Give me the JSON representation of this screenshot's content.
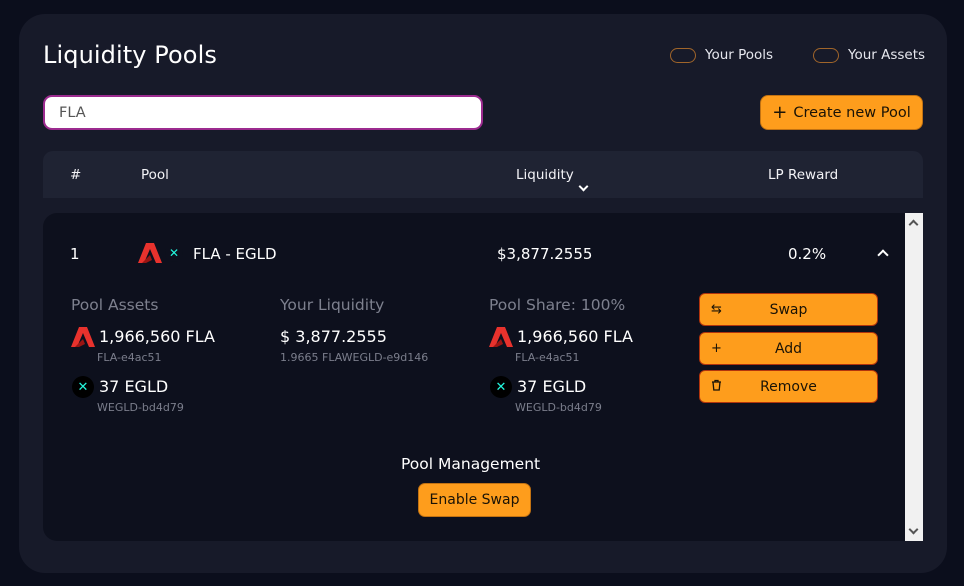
{
  "header": {
    "title": "Liquidity Pools",
    "toggles": [
      {
        "label": "Your Pools",
        "on": false
      },
      {
        "label": "Your Assets",
        "on": false
      }
    ]
  },
  "search": {
    "value": "FLA",
    "placeholder": ""
  },
  "create_button": {
    "label": "Create new Pool",
    "icon": "plus-icon"
  },
  "table": {
    "columns": [
      "#",
      "Pool",
      "Liquidity",
      "LP Reward"
    ],
    "sort_column": "Liquidity"
  },
  "pool": {
    "index": "1",
    "pair": "FLA - EGLD",
    "liquidity": "$3,877.2555",
    "lp_reward": "0.2%",
    "pool_assets": {
      "title": "Pool Assets",
      "token1_amount": "1,966,560 FLA",
      "token1_id": "FLA-e4ac51",
      "token2_amount": "37 EGLD",
      "token2_id": "WEGLD-bd4d79"
    },
    "your_liquidity": {
      "title": "Your Liquidity",
      "value": "$ 3,877.2555",
      "lp_tokens": "1.9665 FLAWEGLD-e9d146"
    },
    "pool_share": {
      "title": "Pool Share: 100%",
      "token1_amount": "1,966,560 FLA",
      "token1_id": "FLA-e4ac51",
      "token2_amount": "37 EGLD",
      "token2_id": "WEGLD-bd4d79"
    },
    "actions": [
      {
        "label": "Swap",
        "icon": "swap-icon"
      },
      {
        "label": "Add",
        "icon": "plus-icon"
      },
      {
        "label": "Remove",
        "icon": "trash-icon"
      }
    ],
    "management": {
      "title": "Pool Management",
      "enable_swap_label": "Enable Swap"
    }
  },
  "colors": {
    "background": "#0b0e1c",
    "panel": "#171a29",
    "accent": "#fe9d1c",
    "egld": "#23f7dd",
    "fla": "#e8322d"
  }
}
